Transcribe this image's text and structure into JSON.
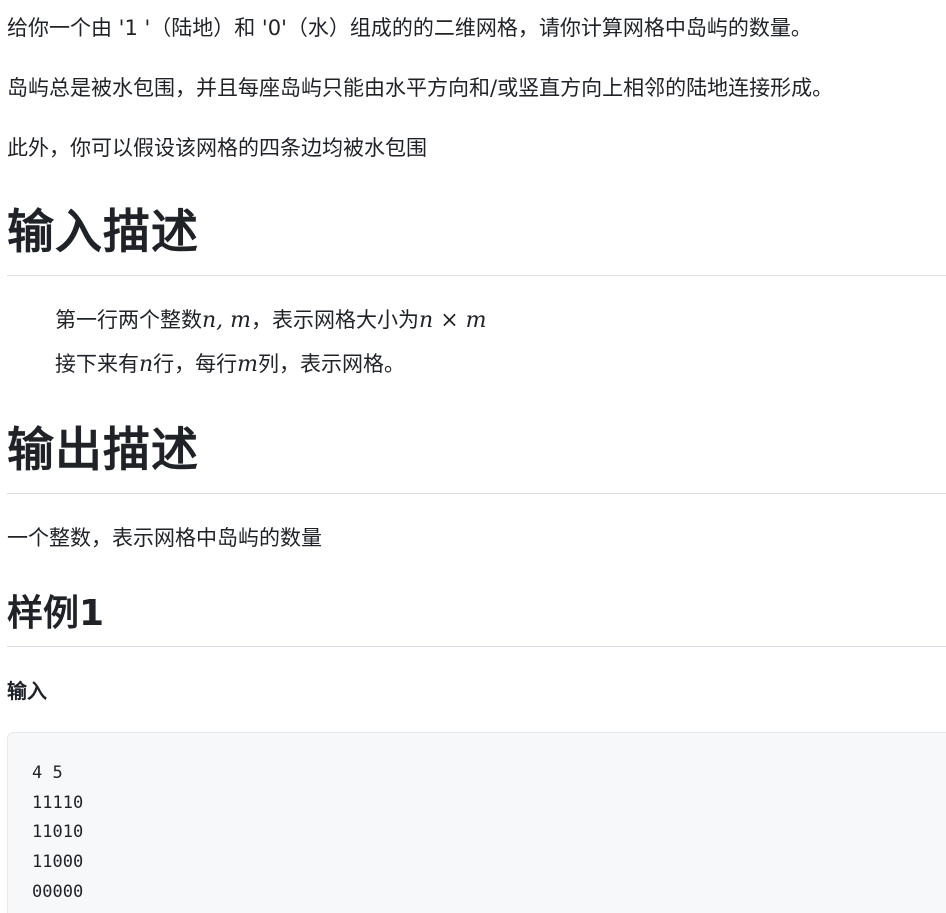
{
  "intro": {
    "p1": "给你一个由 '1 '（陆地）和 '0'（水）组成的的二维网格，请你计算网格中岛屿的数量。",
    "p2": "岛屿总是被水包围，并且每座岛屿只能由水平方向和/或竖直方向上相邻的陆地连接形成。",
    "p3": "此外，你可以假设该网格的四条边均被水包围"
  },
  "input_section": {
    "heading": "输入描述",
    "line1_text": "第一行两个整数",
    "line1_math": "n, m",
    "line1_text2": "，表示网格大小为",
    "line1_math2_a": "n",
    "line1_math2_op": " × ",
    "line1_math2_b": "m",
    "line2_text_a": "接下来有",
    "line2_math_a": "n",
    "line2_text_b": "行，每行",
    "line2_math_b": "m",
    "line2_text_c": "列，表示网格。"
  },
  "output_section": {
    "heading": "输出描述",
    "text": "一个整数，表示网格中岛屿的数量"
  },
  "example": {
    "heading": "样例1",
    "input_label": "输入",
    "input_lines": [
      "4 5",
      "11110",
      "11010",
      "11000",
      "00000"
    ]
  }
}
